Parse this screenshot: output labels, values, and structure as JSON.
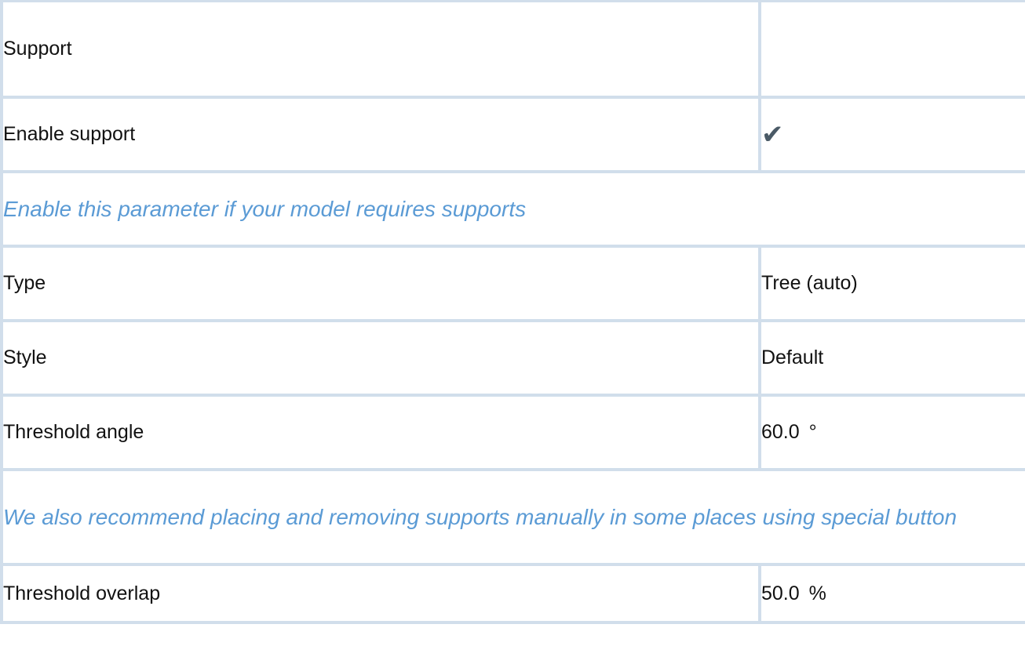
{
  "section": {
    "title": "Support"
  },
  "params": {
    "enable_support": {
      "label": "Enable support",
      "value_icon": "checkmark-icon",
      "value_glyph": "✔"
    },
    "enable_hint": "Enable this parameter if your model requires supports",
    "type": {
      "label": "Type",
      "value": "Tree (auto)"
    },
    "style": {
      "label": "Style",
      "value": "Default"
    },
    "threshold_angle": {
      "label": "Threshold angle",
      "value": "60.0",
      "unit": "°"
    },
    "angle_hint": "We also recommend placing and removing supports manually in some places using special button",
    "threshold_overlap": {
      "label": "Threshold overlap",
      "value": "50.0",
      "unit": "%"
    }
  },
  "colors": {
    "border": "#d1deeb",
    "hint_text": "#5b9bd5",
    "check_icon": "#4a5a66"
  }
}
